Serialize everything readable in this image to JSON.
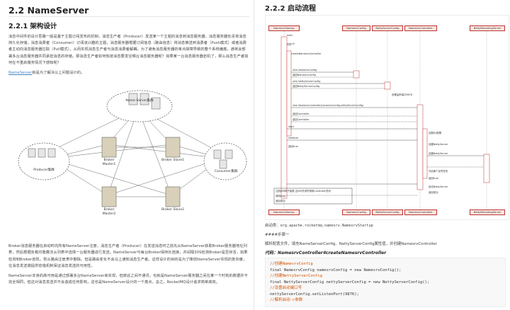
{
  "left": {
    "h2": "2.2 NameServer",
    "h3": "2.2.1 架构设计",
    "p1": "消息中间件的设计思路一般是基于主题订阅发布的机制，消息生产者（Producer）发送某一个主题的消息到消息服务器，消息服务器负责将消息持久化存储，消息消费者（Consumer）订阅该兴趣的主题，消息服务器根据订阅信息（路由信息）将消息推送到消费者（Push模式）或者消费者主动向消息服务器拉取（Pull模式），从而实现消息生产者与消息消费者解耦。为了避免消息服务器的单点故障导致的整个系统瘫痪，通常会部署多台消息服务器共同承担消息的存储。那消息生产者如何知道消息要发往哪台消息服务器呢？如果某一台消息服务器宕机了，那么消息生产者如何在不重启服务情况下感知呢？",
    "p2_link": "NameServer",
    "p2_rest": "就是为了解决以上问题设计的。",
    "diagram": {
      "nameserver_label": "Name Server集群",
      "producer_label": "Producer集群",
      "consumer_label": "Consumer集群",
      "brokers": [
        "Broker Master1",
        "Broker Slave1",
        "Broker Master2",
        "Broker Slave2"
      ]
    },
    "p3": "Broker消息服务器在启动时向所有NameServer注册，消息生产者（Producer）在发送消息时之前先从NameServer获取Broker服务器地址列表，然后根据负载均衡算法从列表中选择一台服务器进行发送。NameServer与每台Broker保持长连接，并间隔30S检测Broker是否存活，如果检测到Broker宕机，则从路由注册表中删除。但是路由变化不会马上通知消息生产者。这样设计的目的是为了降低NameServer实现的复杂度，在消息发送端提供容错机制保证消息发送的可用性。",
    "p4": "NameServer本身的高可用是通过部署多台NameServer来实现，但彼此之间不通讯，也就是NameServer服务器之间在某一个时刻的数据并不完全相同，但这对消息发送并不会造成任何影响，这也是NameServer设计的一个亮点，总之，RocketMQ设计追求简单高效。"
  },
  "right": {
    "h3": "2.2.2 启动流程",
    "seq": {
      "participants": [
        "NamesrvStartup",
        "NamesrvConfig",
        "NettyServerConfig",
        "NamesrvController",
        "NettyRemotingServer"
      ],
      "messages": [
        "main",
        "main0",
        "createNamesrvController",
        "new NamesrvConfig",
        "返回NamesrvConfig",
        "new NettyServerConfig",
        "返回NettyServerConfig",
        "设置监听端口9876",
        "new NamesrvController(namesrvConfig,nettyServerConfig)",
        "返回Controller",
        "返回Controller",
        "start",
        "initialize",
        "返回true",
        "加载KV配置",
        "创建NettyServer",
        "创建NettyServer",
        "开启两个定时任务",
        "返回true",
        "注册JVM钩子函数,当JVM关闭时调用Controller关闭",
        "调用start",
        "返回成功",
        "启动NettyServer",
        "返回成功"
      ]
    },
    "cap1_label": "启动类：",
    "cap1_code": "org.apache.rocketmq.namesrv.NamesrvStartup",
    "step": "####步骤一",
    "cap2": "解析配置文件，填充NameServerConfig、NettyServerConfig属性值，并创建NamesrvController",
    "code_title": "代码：NamesrvController#createNamesrvController",
    "code": [
      "//创建NamesrvConfig",
      "final NamesrvConfig namesrvConfig = new NamesrvConfig();",
      "//创建NettyServerConfig",
      "final NettyServerConfig nettyServerConfig = new NettyServerConfig();",
      "//设置启动端口号",
      "nettyServerConfig.setListenPort(9876);",
      "//解析启动-c参数"
    ]
  }
}
